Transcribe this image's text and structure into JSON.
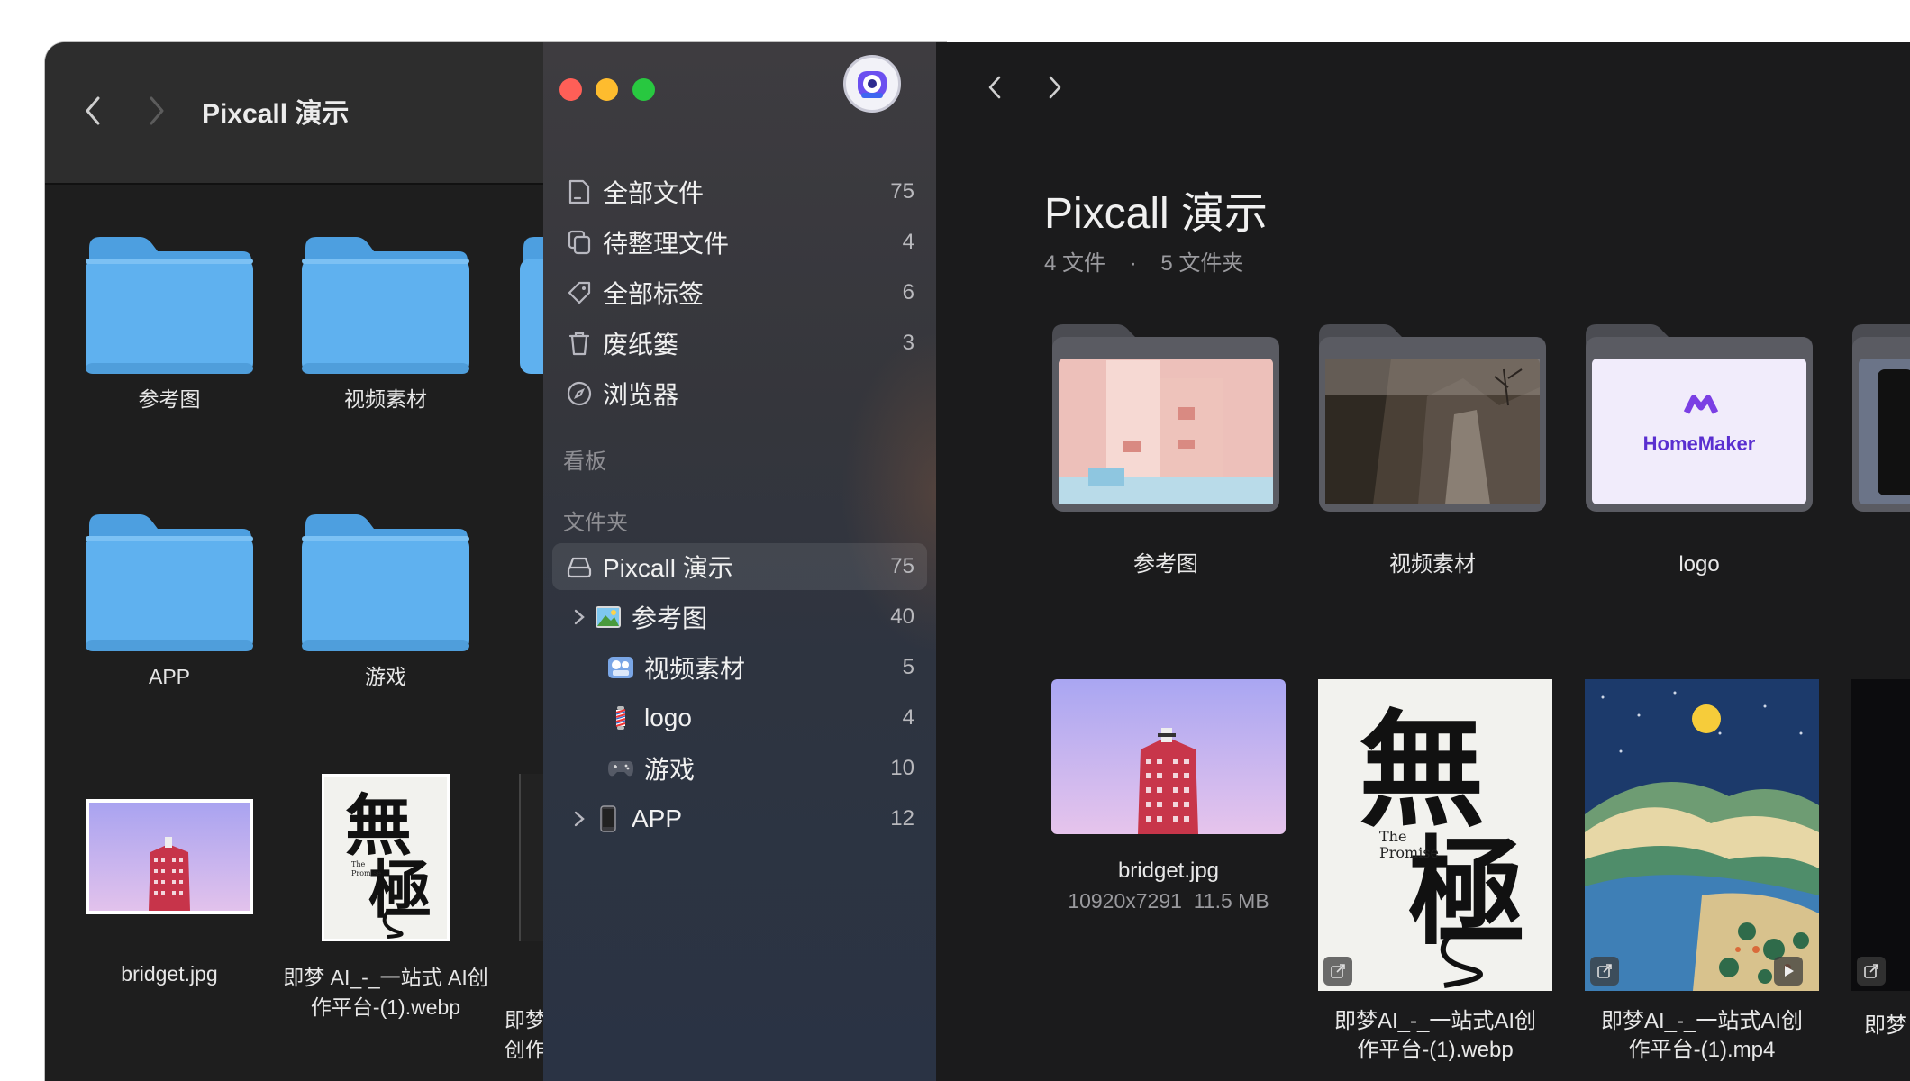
{
  "finder": {
    "title": "Pixcall 演示",
    "items": [
      {
        "label": "参考图"
      },
      {
        "label": "视频素材"
      },
      {
        "label": "APP"
      },
      {
        "label": "游戏"
      },
      {
        "label": "bridget.jpg"
      },
      {
        "label": "即梦 AI_-_一站式 AI创作平台-(1).webp"
      },
      {
        "label": "即梦创作"
      }
    ]
  },
  "sidebar": {
    "nav": [
      {
        "label": "全部文件",
        "count": "75"
      },
      {
        "label": "待整理文件",
        "count": "4"
      },
      {
        "label": "全部标签",
        "count": "6"
      },
      {
        "label": "废纸篓",
        "count": "3"
      },
      {
        "label": "浏览器",
        "count": ""
      }
    ],
    "section_board": "看板",
    "section_folders": "文件夹",
    "folders": [
      {
        "label": "Pixcall 演示",
        "count": "75"
      },
      {
        "label": "参考图",
        "count": "40"
      },
      {
        "label": "视频素材",
        "count": "5"
      },
      {
        "label": "logo",
        "count": "4"
      },
      {
        "label": "游戏",
        "count": "10"
      },
      {
        "label": "APP",
        "count": "12"
      }
    ]
  },
  "main": {
    "title": "Pixcall 演示",
    "files_count": "4 文件",
    "separator": "·",
    "folders_count": "5 文件夹",
    "folders": [
      {
        "label": "参考图"
      },
      {
        "label": "视频素材"
      },
      {
        "label": "logo",
        "logo_text": "HomeMaker"
      }
    ],
    "files": [
      {
        "label": "bridget.jpg",
        "dims": "10920x7291",
        "size": "11.5 MB"
      },
      {
        "label": "即梦AI_-_一站式AI创作平台-(1).webp",
        "line1": "即梦AI_-_一站式AI创",
        "line2": "作平台-(1).webp"
      },
      {
        "label": "即梦AI_-_一站式AI创作平台-(1).mp4",
        "line1": "即梦AI_-_一站式AI创",
        "line2": "作平台-(1).mp4"
      },
      {
        "label": "即梦"
      }
    ],
    "poster_text": {
      "big1": "無",
      "big2": "極",
      "line1": "The",
      "line2": "Promise"
    }
  },
  "colors": {
    "folder_blue": "#5fb1ef",
    "traffic_red": "#ff5f57",
    "traffic_yellow": "#febc2e",
    "traffic_green": "#28c840"
  }
}
